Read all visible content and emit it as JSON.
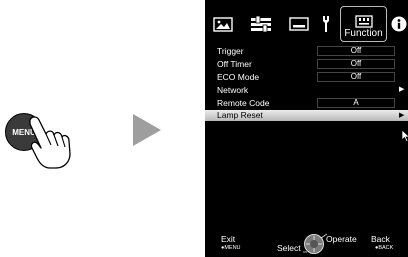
{
  "illustration": {
    "menu_button_label": "MENU",
    "icons": [
      "hand-pointer-icon",
      "arrow-right-icon"
    ]
  },
  "tabs": [
    {
      "name": "picture-icon"
    },
    {
      "name": "adjust-icon"
    },
    {
      "name": "display-icon"
    },
    {
      "name": "installation-icon"
    },
    {
      "name": "function-icon",
      "label": "Function",
      "selected": true
    },
    {
      "name": "info-icon"
    }
  ],
  "menu": {
    "items": [
      {
        "label": "Trigger",
        "value": "Off"
      },
      {
        "label": "Off Timer",
        "value": "Off"
      },
      {
        "label": "ECO Mode",
        "value": "Off"
      },
      {
        "label": "Network",
        "has_submenu": true
      },
      {
        "label": "Remote Code",
        "value": "A"
      },
      {
        "label": "Lamp Reset",
        "has_submenu": true,
        "selected": true
      }
    ]
  },
  "footer": {
    "exit": "Exit",
    "exit_key": "●MENU",
    "select": "Select",
    "operate": "Operate",
    "back": "Back",
    "back_key": "●BACK"
  }
}
